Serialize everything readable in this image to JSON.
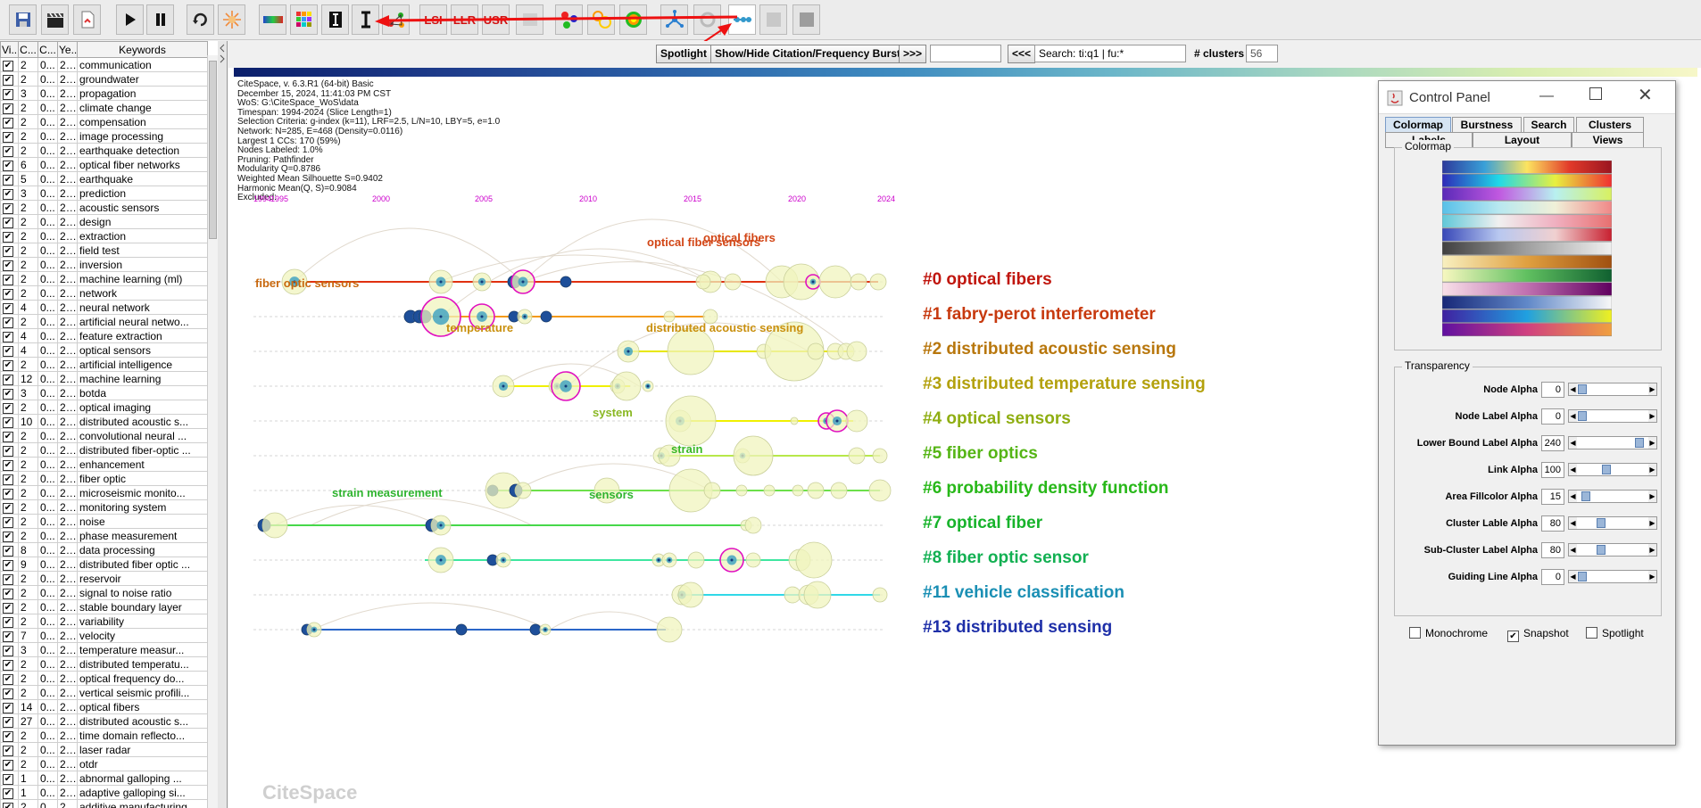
{
  "toolbar": {
    "lsi_label": "LSI",
    "llr_label": "LLR",
    "usr_label": "USR"
  },
  "table": {
    "headers": [
      "Vi...",
      "C...",
      "C...",
      "Ye...",
      "Keywords"
    ],
    "rows": [
      [
        "2",
        "0...",
        "20...",
        "communication"
      ],
      [
        "2",
        "0...",
        "20...",
        "groundwater"
      ],
      [
        "3",
        "0...",
        "20...",
        "propagation"
      ],
      [
        "2",
        "0...",
        "20...",
        "climate change"
      ],
      [
        "2",
        "0...",
        "20...",
        "compensation"
      ],
      [
        "2",
        "0...",
        "20...",
        "image processing"
      ],
      [
        "2",
        "0...",
        "20...",
        "earthquake detection"
      ],
      [
        "6",
        "0...",
        "20...",
        "optical fiber networks"
      ],
      [
        "5",
        "0...",
        "20...",
        "earthquake"
      ],
      [
        "3",
        "0...",
        "20...",
        "prediction"
      ],
      [
        "2",
        "0...",
        "20...",
        "acoustic sensors"
      ],
      [
        "2",
        "0...",
        "20...",
        "design"
      ],
      [
        "2",
        "0...",
        "20...",
        "extraction"
      ],
      [
        "2",
        "0...",
        "20...",
        "field test"
      ],
      [
        "2",
        "0...",
        "20...",
        "inversion"
      ],
      [
        "2",
        "0...",
        "20...",
        "machine learning (ml)"
      ],
      [
        "2",
        "0...",
        "20...",
        "network"
      ],
      [
        "4",
        "0...",
        "20...",
        "neural network"
      ],
      [
        "2",
        "0...",
        "20...",
        "artificial neural netwo..."
      ],
      [
        "4",
        "0...",
        "20...",
        "feature extraction"
      ],
      [
        "4",
        "0...",
        "20...",
        "optical sensors"
      ],
      [
        "2",
        "0...",
        "20...",
        "artificial intelligence"
      ],
      [
        "12",
        "0...",
        "20...",
        "machine learning"
      ],
      [
        "3",
        "0...",
        "20...",
        "botda"
      ],
      [
        "2",
        "0...",
        "20...",
        "optical imaging"
      ],
      [
        "10",
        "0...",
        "20...",
        "distributed acoustic s..."
      ],
      [
        "2",
        "0...",
        "20...",
        "convolutional neural ..."
      ],
      [
        "2",
        "0...",
        "20...",
        "distributed fiber-optic ..."
      ],
      [
        "2",
        "0...",
        "20...",
        "enhancement"
      ],
      [
        "2",
        "0...",
        "20...",
        "fiber optic"
      ],
      [
        "2",
        "0...",
        "20...",
        "microseismic monito..."
      ],
      [
        "2",
        "0...",
        "20...",
        "monitoring system"
      ],
      [
        "2",
        "0...",
        "20...",
        "noise"
      ],
      [
        "2",
        "0...",
        "20...",
        "phase measurement"
      ],
      [
        "8",
        "0...",
        "20...",
        "data processing"
      ],
      [
        "9",
        "0...",
        "20...",
        "distributed fiber optic ..."
      ],
      [
        "2",
        "0...",
        "20...",
        "reservoir"
      ],
      [
        "2",
        "0...",
        "20...",
        "signal to noise ratio"
      ],
      [
        "2",
        "0...",
        "20...",
        "stable boundary layer"
      ],
      [
        "2",
        "0...",
        "20...",
        "variability"
      ],
      [
        "7",
        "0...",
        "20...",
        "velocity"
      ],
      [
        "3",
        "0...",
        "20...",
        "temperature measur..."
      ],
      [
        "2",
        "0...",
        "20...",
        "distributed temperatu..."
      ],
      [
        "2",
        "0...",
        "20...",
        "optical frequency do..."
      ],
      [
        "2",
        "0...",
        "20...",
        "vertical seismic profili..."
      ],
      [
        "14",
        "0...",
        "20...",
        "optical fibers"
      ],
      [
        "27",
        "0...",
        "20...",
        "distributed acoustic s..."
      ],
      [
        "2",
        "0...",
        "20...",
        "time domain reflecto..."
      ],
      [
        "2",
        "0...",
        "20...",
        "laser radar"
      ],
      [
        "2",
        "0...",
        "20...",
        "otdr"
      ],
      [
        "1",
        "0...",
        "20...",
        "abnormal galloping ..."
      ],
      [
        "1",
        "0...",
        "20...",
        "adaptive galloping si..."
      ],
      [
        "2",
        "0...",
        "20...",
        "additive manufacturing"
      ]
    ]
  },
  "topbar": {
    "spotlight_label": "Spotlight",
    "burst_label": "Show/Hide Citation/Frequency Burst",
    "next_label": ">>>",
    "prev_label": "<<<",
    "search_value": "Search: ti:q1 | fu:*",
    "clusters_label": "# clusters",
    "clusters_value": "56"
  },
  "info": [
    "CiteSpace, v. 6.3.R1 (64-bit) Basic",
    "December 15, 2024, 11:41:03 PM CST",
    "WoS: G:\\CiteSpace_WoS\\data",
    "Timespan: 1994-2024 (Slice Length=1)",
    "Selection Criteria: g-index (k=11), LRF=2.5, L/N=10, LBY=5, e=1.0",
    "Network: N=285, E=468 (Density=0.0116)",
    "Largest 1 CCs: 170 (59%)",
    "Nodes Labeled: 1.0%",
    "Pruning: Pathfinder",
    "Modularity Q=0.8786",
    "Weighted Mean Silhouette S=0.9402",
    "Harmonic Mean(Q, S)=0.9084",
    "Excluded:"
  ],
  "years": [
    "1994",
    "1995",
    "2000",
    "2005",
    "2010",
    "2015",
    "2020",
    "2024"
  ],
  "clusters": [
    {
      "label": "#0 optical fibers",
      "color": "#c0160e"
    },
    {
      "label": "#1 fabry-perot interferometer",
      "color": "#c7390e"
    },
    {
      "label": "#2 distributed acoustic sensing",
      "color": "#b8770d"
    },
    {
      "label": "#3 distributed temperature sensing",
      "color": "#b3a10d"
    },
    {
      "label": "#4 optical sensors",
      "color": "#8fae12"
    },
    {
      "label": "#5 fiber optics",
      "color": "#55b515"
    },
    {
      "label": "#6 probability density function",
      "color": "#28b819"
    },
    {
      "label": "#7 optical fiber",
      "color": "#17b32b"
    },
    {
      "label": "#8 fiber optic sensor",
      "color": "#12b052"
    },
    {
      "label": "#11 vehicle classification",
      "color": "#1a8fb4"
    },
    {
      "label": "#13 distributed sensing",
      "color": "#1e2fa8"
    }
  ],
  "sublabels": {
    "optical_fiber_sensors": "optical fiber sensors",
    "optical_fibers": "optical fibers",
    "fiber_optic_sensors": "fiber optic sensors",
    "temperature": "temperature",
    "distributed_acoustic_sensing": "distributed acoustic sensing",
    "system": "system",
    "strain": "strain",
    "strain_measurement": "strain measurement",
    "sensors": "sensors"
  },
  "watermark": "CiteSpace",
  "control_panel": {
    "title": "Control Panel",
    "tabs_row1": [
      "Colormap",
      "Burstness",
      "Search",
      "Clusters"
    ],
    "tabs_row2": [
      "Labels",
      "Layout",
      "Views"
    ],
    "colormap_group": "Colormap",
    "transparency_group": "Transparency",
    "sliders": [
      {
        "label": "Node Alpha",
        "value": "0",
        "level": 0
      },
      {
        "label": "Node Label Alpha",
        "value": "0",
        "level": 0
      },
      {
        "label": "Lower Bound Label Alpha",
        "value": "240",
        "level": 0.94
      },
      {
        "label": "Link Alpha",
        "value": "100",
        "level": 0.39
      },
      {
        "label": "Area Fillcolor Alpha",
        "value": "15",
        "level": 0.06
      },
      {
        "label": "Cluster Lable Alpha",
        "value": "80",
        "level": 0.31
      },
      {
        "label": "Sub-Cluster Label Alpha",
        "value": "80",
        "level": 0.31
      },
      {
        "label": "Guiding Line Alpha",
        "value": "0",
        "level": 0
      }
    ],
    "checkboxes": [
      {
        "label": "Monochrome",
        "checked": false
      },
      {
        "label": "Snapshot",
        "checked": true
      },
      {
        "label": "Spotlight",
        "checked": false
      }
    ]
  }
}
